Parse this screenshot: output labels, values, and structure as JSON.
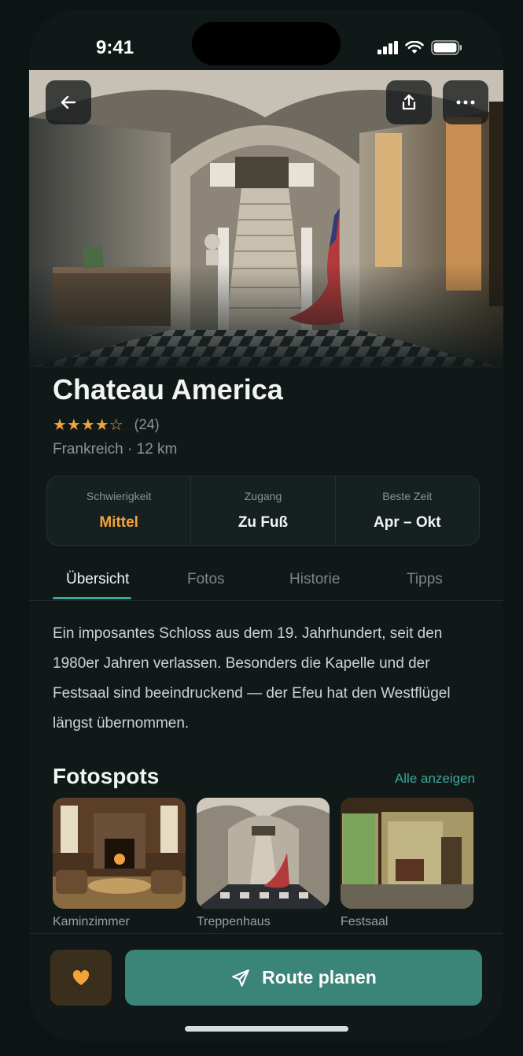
{
  "status_bar": {
    "time": "9:41"
  },
  "hero": {
    "alt": "Chateau America interior staircase"
  },
  "place": {
    "title": "Chateau America",
    "stars": "★★★★☆",
    "rating": 4,
    "review_count": "(24)",
    "subtitle": "Frankreich · 12 km"
  },
  "info": [
    {
      "label": "Schwierigkeit",
      "value": "Mittel"
    },
    {
      "label": "Zugang",
      "value": "Zu Fuß"
    },
    {
      "label": "Beste Zeit",
      "value": "Apr – Okt"
    }
  ],
  "tabs": [
    {
      "label": "Übersicht",
      "active": true
    },
    {
      "label": "Fotos",
      "active": false
    },
    {
      "label": "Historie",
      "active": false
    },
    {
      "label": "Tipps",
      "active": false
    }
  ],
  "description": "Ein imposantes Schloss aus dem 19. Jahrhundert, seit den 1980er Jahren verlassen. Besonders die Kapelle und der Festsaal sind beeindruckend — der Efeu hat den Westflügel längst übernommen.",
  "photospots": {
    "title": "Fotospots",
    "see_all": "Alle anzeigen",
    "items": [
      {
        "caption": "Kaminzimmer"
      },
      {
        "caption": "Treppenhaus"
      },
      {
        "caption": "Festsaal"
      }
    ]
  },
  "actions": {
    "favorite_icon": "heart-icon",
    "route_label": "Route planen",
    "route_icon": "send-icon"
  },
  "colors": {
    "accent": "#3aa89a",
    "warning": "#f2a33a",
    "primary_button": "#3a8478"
  }
}
